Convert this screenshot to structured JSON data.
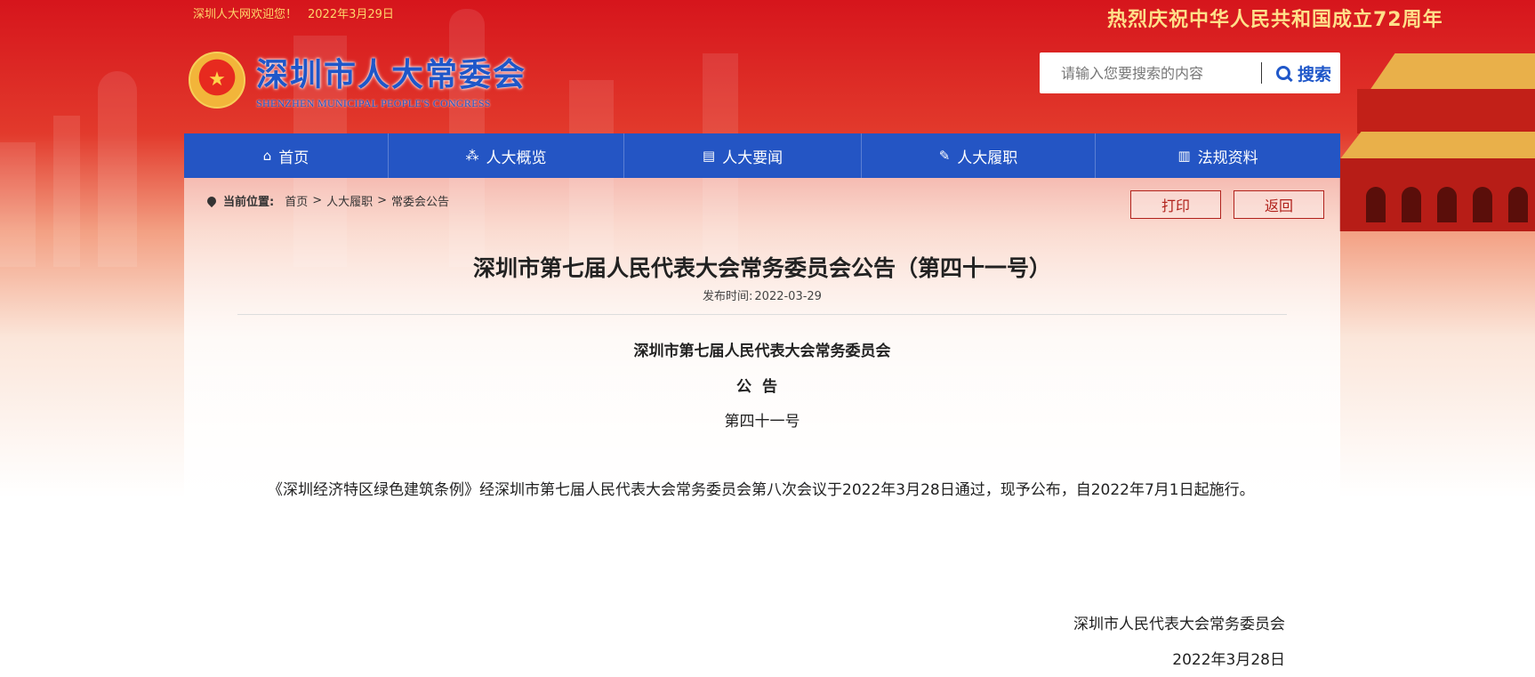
{
  "topbar": {
    "welcome": "深圳人大网欢迎您！",
    "date": "2022年3月29日",
    "celebrate": "热烈庆祝中华人民共和国成立72周年"
  },
  "logo": {
    "cn": "深圳市人大常委会",
    "en": "SHENZHEN MUNICIPAL PEOPLE'S CONGRESS"
  },
  "search": {
    "placeholder": "请输入您要搜索的内容",
    "button": "搜索"
  },
  "nav": {
    "items": [
      {
        "label": "首页",
        "icon": "home-icon"
      },
      {
        "label": "人大概览",
        "icon": "org-chart-icon"
      },
      {
        "label": "人大要闻",
        "icon": "news-icon"
      },
      {
        "label": "人大履职",
        "icon": "duty-icon"
      },
      {
        "label": "法规资料",
        "icon": "books-icon"
      }
    ]
  },
  "breadcrumb": {
    "label": "当前位置:",
    "items": [
      "首页",
      "人大履职",
      "常委会公告"
    ],
    "sep": ">"
  },
  "actions": {
    "print": "打印",
    "back": "返回"
  },
  "article": {
    "title": "深圳市第七届人民代表大会常务委员会公告（第四十一号）",
    "pubtime_label": "发布时间:",
    "pubtime": "2022-03-29",
    "heading1": "深圳市第七届人民代表大会常务委员会",
    "heading2": "公告",
    "heading3": "第四十一号",
    "body": "《深圳经济特区绿色建筑条例》经深圳市第七届人民代表大会常务委员会第八次会议于2022年3月28日通过，现予公布，自2022年7月1日起施行。",
    "signature": "深圳市人民代表大会常务委员会",
    "date": "2022年3月28日"
  }
}
